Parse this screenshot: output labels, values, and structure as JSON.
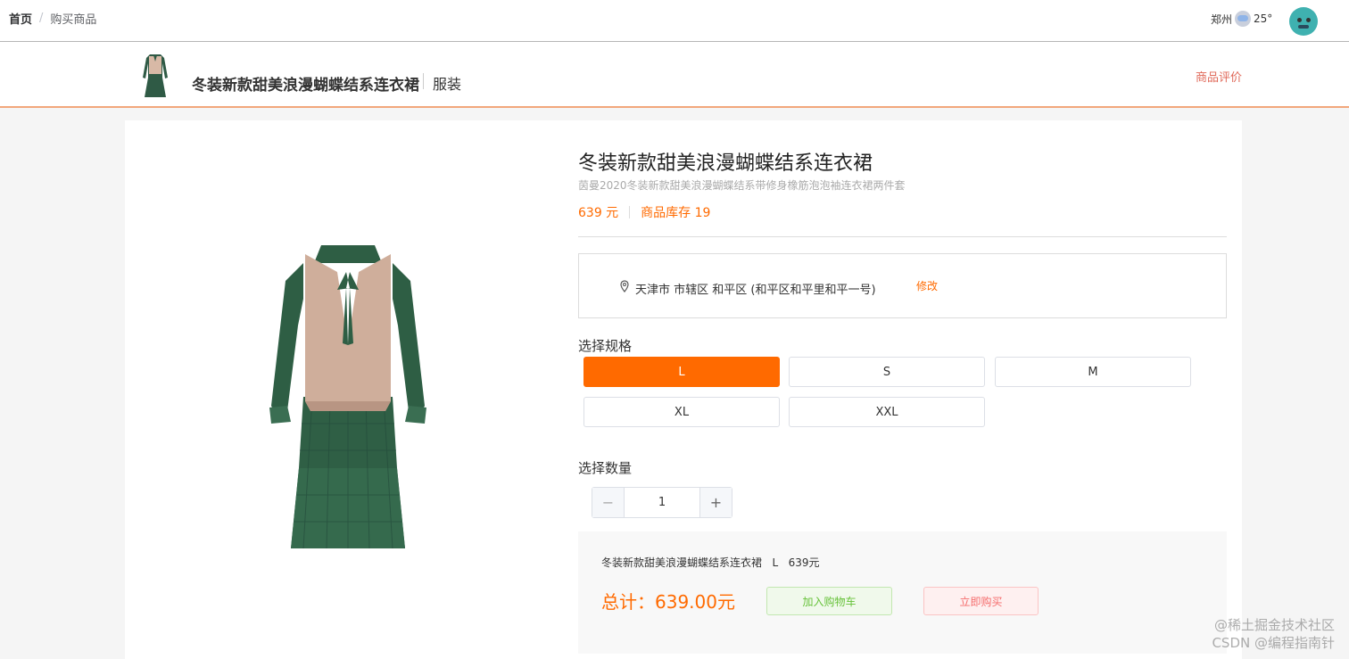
{
  "breadcrumb": {
    "home": "首页",
    "separator": "/",
    "current": "购买商品"
  },
  "weather": {
    "city": "郑州",
    "temp": "25°",
    "icon": "cloud-rain-icon"
  },
  "header": {
    "title": "冬装新款甜美浪漫蝴蝶结系连衣裙",
    "category": "服装",
    "review_link": "商品评价"
  },
  "product": {
    "title": "冬装新款甜美浪漫蝴蝶结系连衣裙",
    "subtitle": "茵曼2020冬装新款甜美浪漫蝴蝶结系带修身橡筋泡泡袖连衣裙两件套",
    "price": "639 元",
    "stock": "商品库存 19"
  },
  "address": {
    "text": "天津市 市辖区 和平区 (和平区和平里和平一号)",
    "edit": "修改"
  },
  "spec": {
    "label": "选择规格",
    "options": [
      "L",
      "S",
      "M",
      "XL",
      "XXL"
    ],
    "selected": "L"
  },
  "quantity": {
    "label": "选择数量",
    "value": "1",
    "minus": "−",
    "plus": "+"
  },
  "summary": {
    "line": "冬装新款甜美浪漫蝴蝶结系连衣裙   L   639元",
    "total": "总计：639.00元",
    "add_to_cart": "加入购物车",
    "buy_now": "立即购买"
  },
  "watermark": {
    "line1": "@稀土掘金技术社区",
    "line2": "CSDN @编程指南针"
  },
  "colors": {
    "accent": "#ff6a00",
    "success": "#67c23a",
    "danger": "#f56c6c"
  }
}
